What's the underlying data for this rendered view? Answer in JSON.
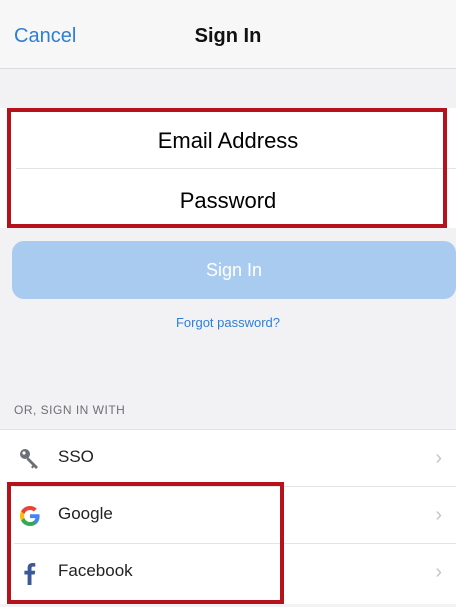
{
  "nav": {
    "cancel_label": "Cancel",
    "title": "Sign In"
  },
  "form": {
    "email_label": "Email Address",
    "password_label": "Password"
  },
  "signin_button": {
    "label": "Sign In"
  },
  "forgot_password": {
    "label": "Forgot password?"
  },
  "alternatives": {
    "section_label": "OR, SIGN IN WITH",
    "items": [
      {
        "label": "SSO",
        "icon": "key-icon"
      },
      {
        "label": "Google",
        "icon": "google-icon"
      },
      {
        "label": "Facebook",
        "icon": "facebook-icon"
      }
    ]
  },
  "colors": {
    "accent": "#2d7fd3",
    "button_disabled": "#a9cbf0",
    "highlight": "#b5121b",
    "facebook": "#3b5998"
  }
}
